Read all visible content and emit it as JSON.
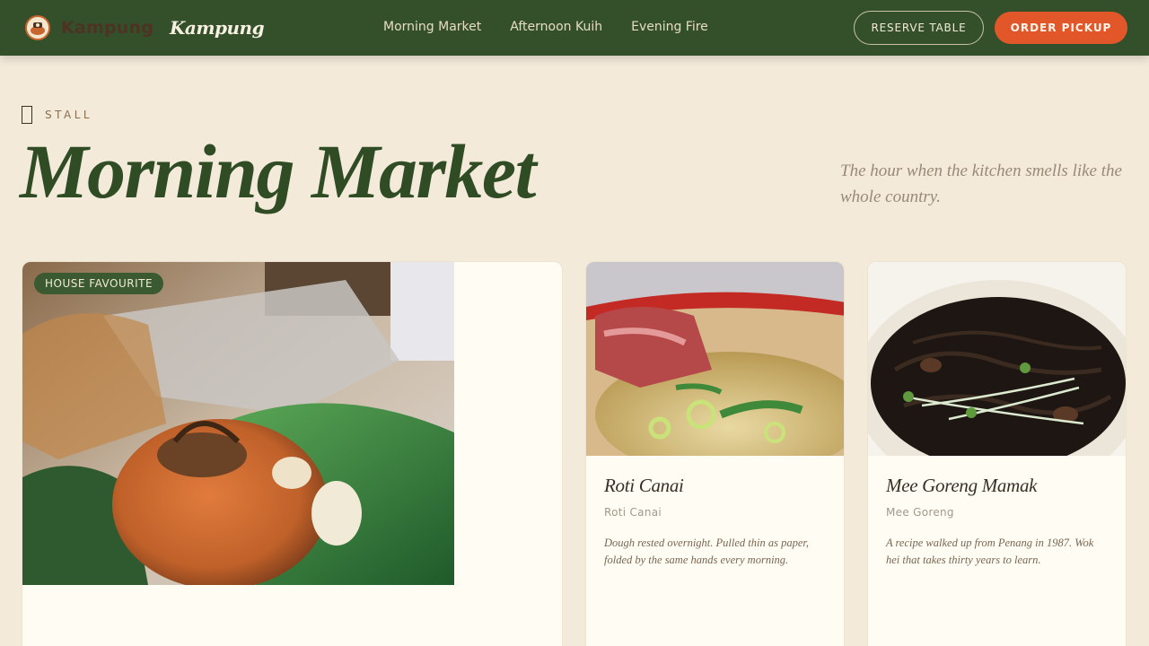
{
  "header": {
    "brand_wordmark": "Kampung",
    "brand_script": "Kampung",
    "nav": [
      "Morning Market",
      "Afternoon Kuih",
      "Evening Fire"
    ],
    "reserve_label": "RESERVE TABLE",
    "order_label": "ORDER PICKUP"
  },
  "hero": {
    "eyebrow": "STALL",
    "title": "Morning Market",
    "tagline": "The hour when the kitchen smells like the whole country."
  },
  "cards": [
    {
      "badge": "HOUSE FAVOURITE",
      "photo": "nasi-lemak-photo"
    },
    {
      "name": "Roti Canai",
      "subtitle": "Roti Canai",
      "description": "Dough rested overnight. Pulled thin as paper, folded by the same hands every morning.",
      "photo": "roti-canai-photo"
    },
    {
      "name": "Mee Goreng Mamak",
      "subtitle": "Mee Goreng",
      "description": "A recipe walked up from Penang in 1987. Wok hei that takes thirty years to learn.",
      "photo": "mee-goreng-photo"
    }
  ],
  "colors": {
    "header_bg": "#33502a",
    "page_bg": "#f3eada",
    "accent": "#e2572a",
    "title": "#2f4c24"
  }
}
